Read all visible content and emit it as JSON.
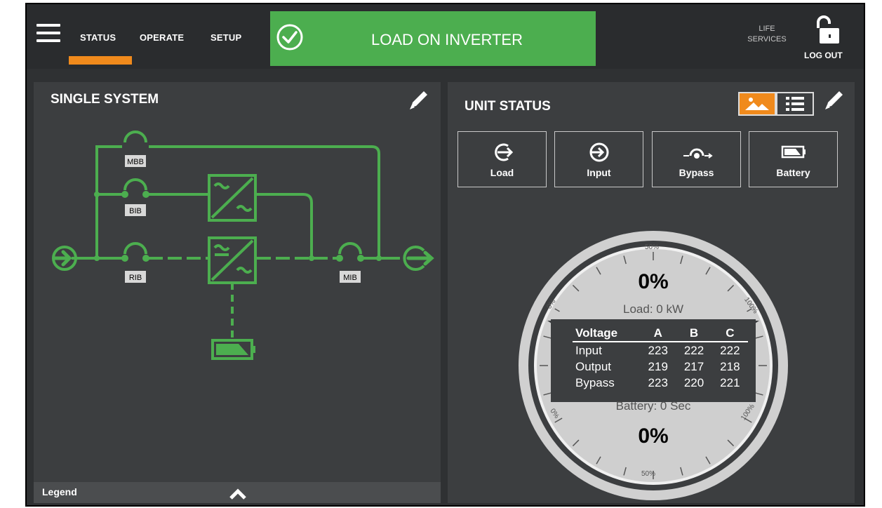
{
  "nav": {
    "tabs": [
      "STATUS",
      "OPERATE",
      "SETUP"
    ],
    "active_tab": "STATUS"
  },
  "banner": {
    "text": "LOAD ON INVERTER",
    "color": "#4cae4f"
  },
  "header_right": {
    "life_line1": "LIFE",
    "life_line2": "SERVICES",
    "logout": "LOG OUT"
  },
  "single_system": {
    "title": "SINGLE SYSTEM",
    "breakers": [
      "MBB",
      "BIB",
      "RIB",
      "MIB"
    ],
    "legend": "Legend"
  },
  "unit_status": {
    "title": "UNIT STATUS",
    "buttons": [
      "Load",
      "Input",
      "Bypass",
      "Battery"
    ],
    "gauge": {
      "load_percent": "0%",
      "load_label": "Load: 0 kW",
      "battery_label": "Battery: 0 Sec",
      "battery_percent": "0%",
      "scale": {
        "top": "50%",
        "top_left": "0%",
        "top_right": "100%",
        "bottom": "50%",
        "bottom_left": "0%",
        "bottom_right": "100%"
      }
    },
    "voltage_table": {
      "headers": [
        "Voltage",
        "A",
        "B",
        "C"
      ],
      "rows": [
        [
          "Input",
          "223",
          "222",
          "222"
        ],
        [
          "Output",
          "219",
          "217",
          "218"
        ],
        [
          "Bypass",
          "223",
          "220",
          "221"
        ]
      ]
    }
  },
  "colors": {
    "accent": "#f08a1c",
    "line_green": "#4cae4f",
    "panel": "#3c3e40"
  }
}
